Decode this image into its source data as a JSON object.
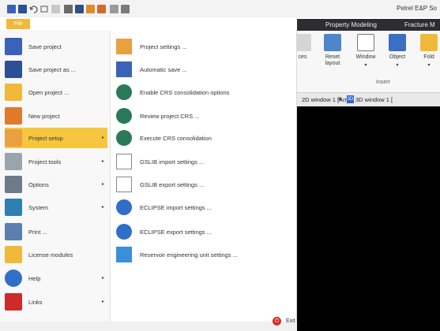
{
  "titlebar": {
    "app_title": "Petrel E&P So"
  },
  "file_tab": {
    "label": "File"
  },
  "ribbon": {
    "tabs": [
      "Property Modeling",
      "Fracture M"
    ],
    "buttons": [
      {
        "label": "ces",
        "icon": "settings-icon"
      },
      {
        "label": "Reset\nlayout",
        "icon": "reset-layout-icon"
      },
      {
        "label": "Window",
        "icon": "window-icon"
      },
      {
        "label": "Object",
        "icon": "object-icon"
      },
      {
        "label": "Fold",
        "icon": "folder-icon"
      }
    ],
    "group_label": "Insert"
  },
  "window_tabs": {
    "tab1": "2D window 1 [Any]",
    "close": "×",
    "badge": "3D",
    "tab2": "3D window 1 ["
  },
  "menu": {
    "left_items": [
      {
        "label": "Save project",
        "icon": "save-icon"
      },
      {
        "label": "Save project as ...",
        "icon": "save-as-icon"
      },
      {
        "label": "Open project ...",
        "icon": "open-folder-icon"
      },
      {
        "label": "New project",
        "icon": "new-project-icon"
      },
      {
        "label": "Project setup",
        "icon": "project-setup-icon",
        "arrow": "▸"
      },
      {
        "label": "Project tools",
        "icon": "wrench-icon",
        "arrow": "▸"
      },
      {
        "label": "Options",
        "icon": "options-icon",
        "arrow": "▸"
      },
      {
        "label": "System",
        "icon": "monitor-icon",
        "arrow": "▸"
      },
      {
        "label": "Print ...",
        "icon": "printer-icon"
      },
      {
        "label": "License modules",
        "icon": "key-icon"
      },
      {
        "label": "Help",
        "icon": "help-icon",
        "arrow": "▸"
      },
      {
        "label": "Links",
        "icon": "bookmark-icon",
        "arrow": "▸"
      }
    ],
    "right_items": [
      {
        "label": "Project settings ...",
        "icon": "project-settings-icon"
      },
      {
        "label": "Automatic save ...",
        "icon": "automatic-save-icon"
      },
      {
        "label": "Enable CRS consolidation options",
        "icon": "globe-icon"
      },
      {
        "label": "Review project CRS ...",
        "icon": "globe-icon"
      },
      {
        "label": "Execute CRS consolidation",
        "icon": "globe-icon"
      },
      {
        "label": "GSLIB import settings ...",
        "icon": "document-gear-icon"
      },
      {
        "label": "GSLIB export settings ...",
        "icon": "document-gear-icon"
      },
      {
        "label": "ECLIPSE import settings ...",
        "icon": "gear-icon"
      },
      {
        "label": "ECLIPSE export settings ...",
        "icon": "gear-icon"
      },
      {
        "label": "Reservoir engineering unit settings ...",
        "icon": "book-icon"
      }
    ],
    "exit_label": "Exit"
  },
  "colors": {
    "active": "#f6c63e",
    "file_tab": "#f0b93a",
    "ribbon_dark": "#2d2d30",
    "viewport": "#000000"
  }
}
